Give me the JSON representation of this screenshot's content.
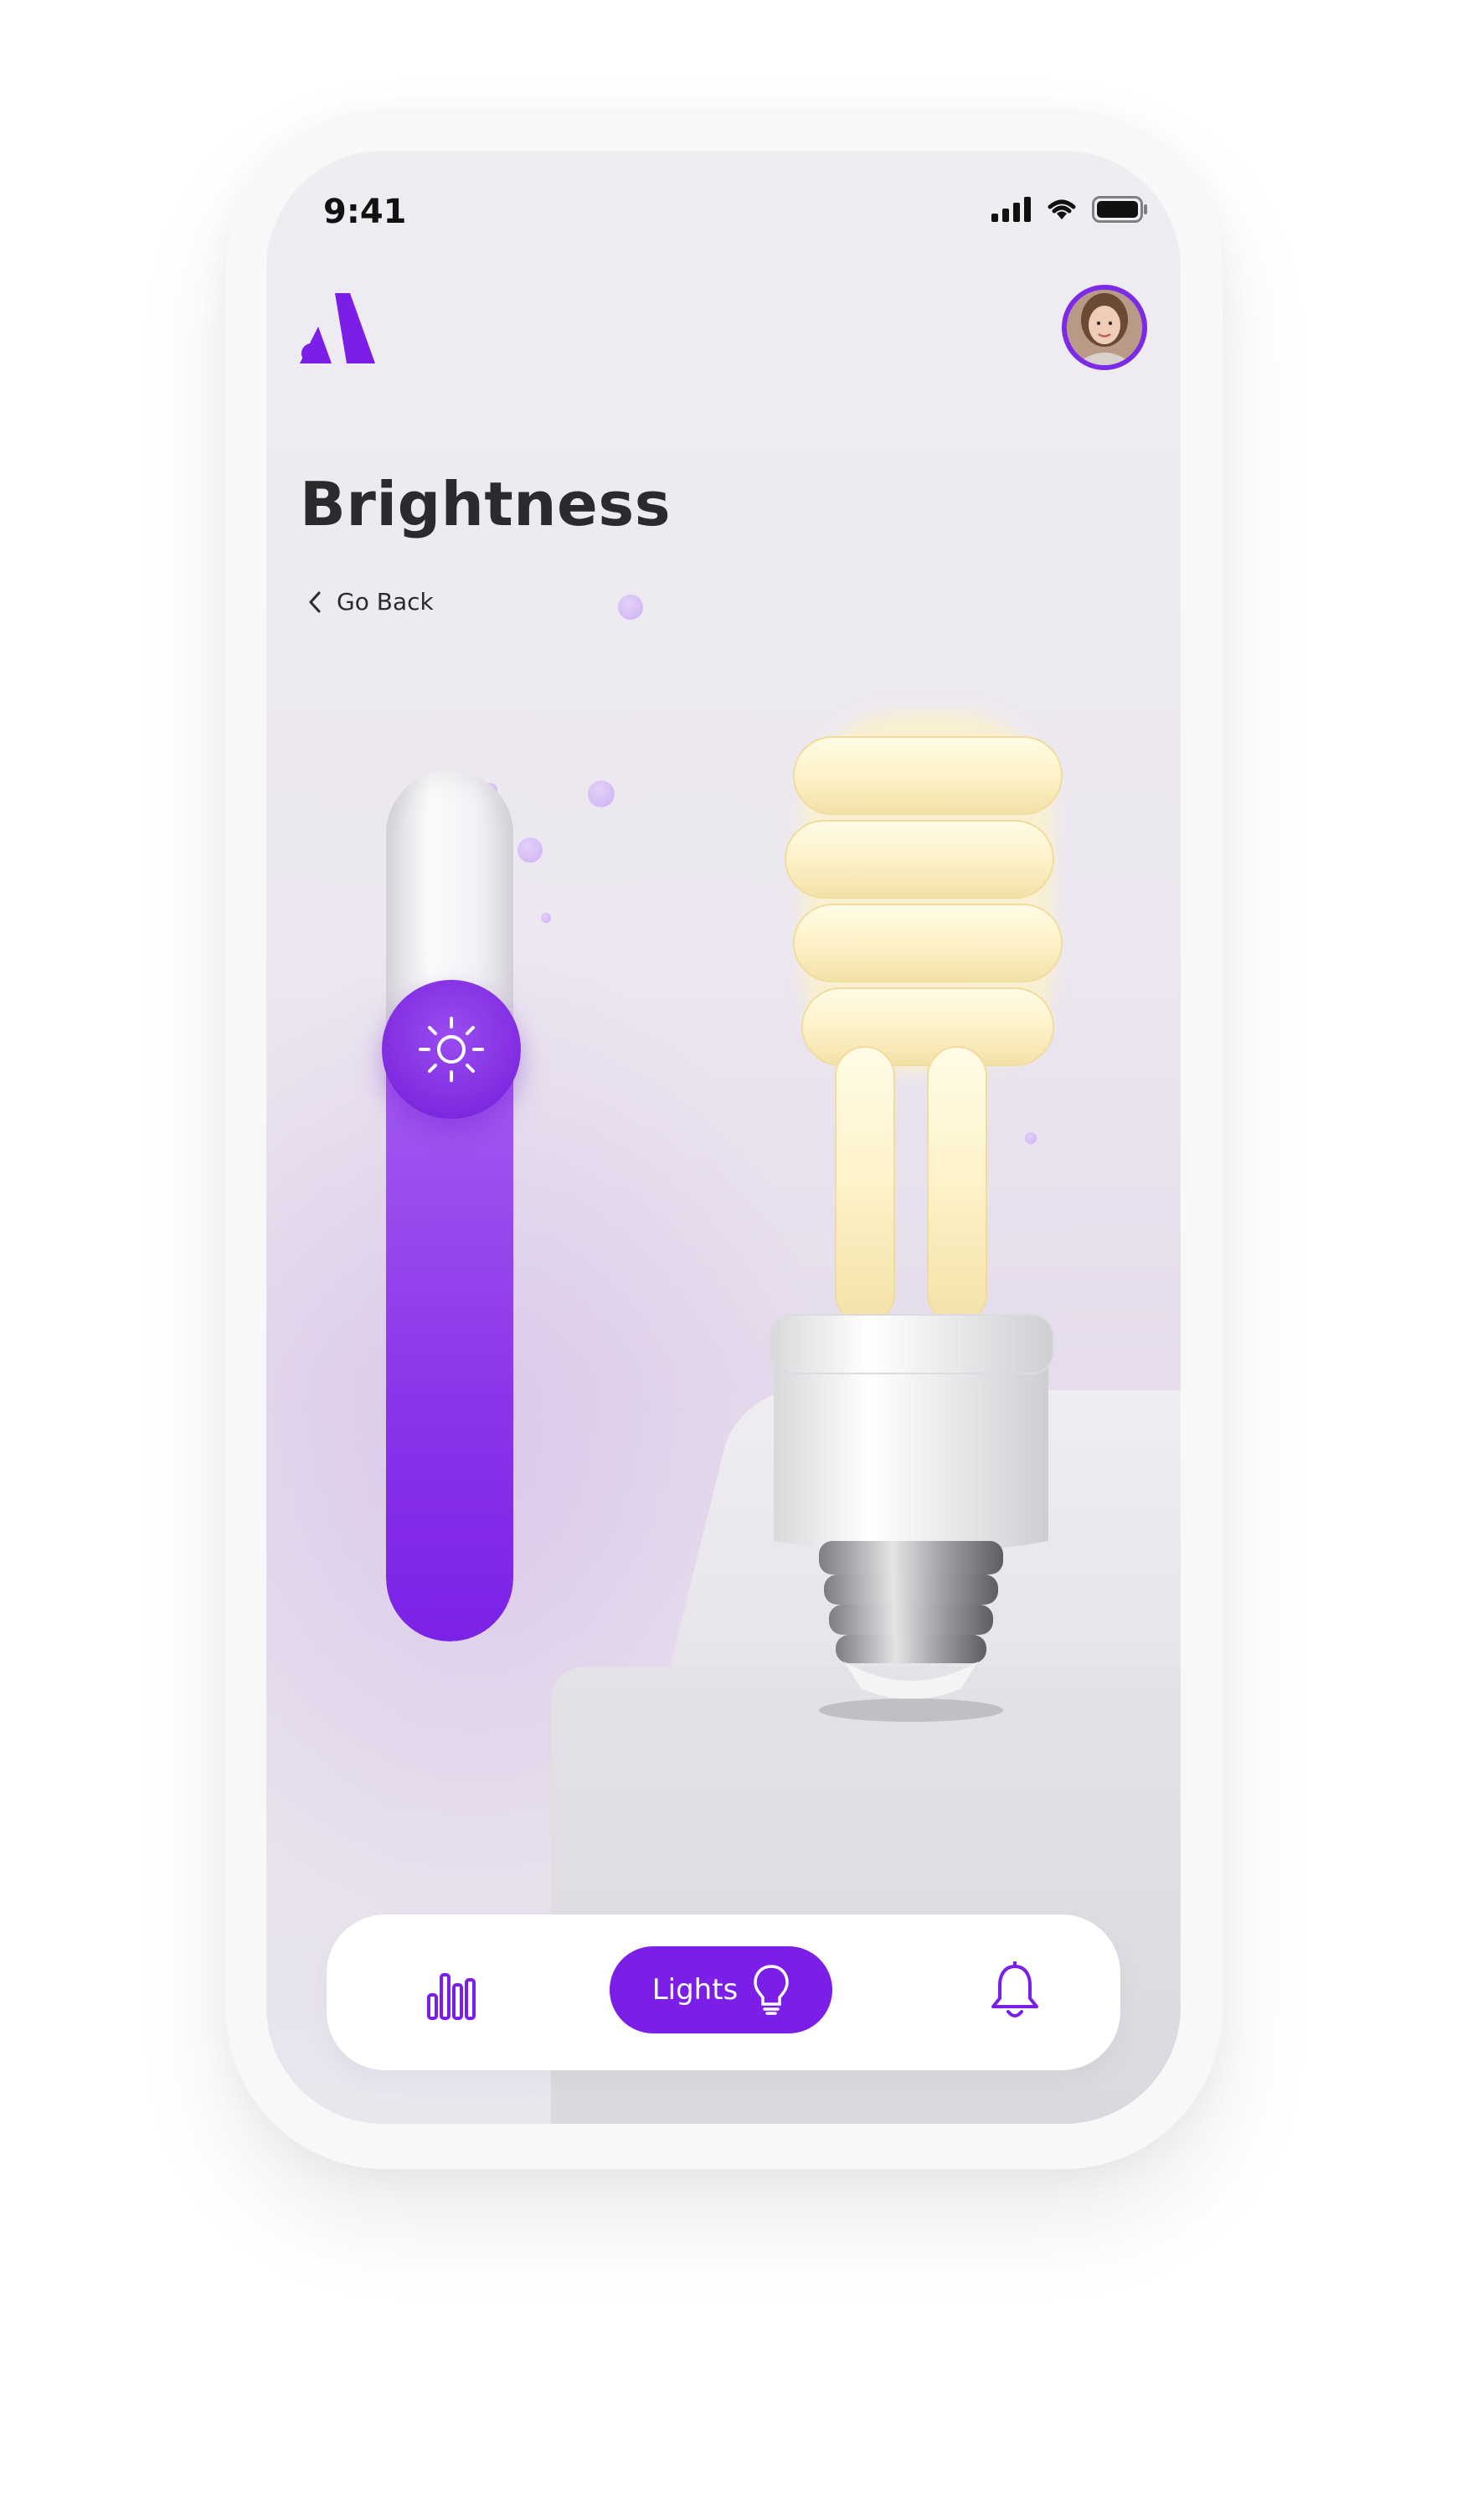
{
  "status_bar": {
    "time": "9:41"
  },
  "header": {
    "logo_icon": "brand-a-logo-icon",
    "avatar": "user-avatar"
  },
  "page": {
    "title": "Brightness",
    "back_label": "Go Back"
  },
  "brightness": {
    "level": 0.68,
    "icon": "sun-icon"
  },
  "bottom_nav": {
    "items": [
      {
        "name": "stats",
        "icon": "bar-chart-icon",
        "label": ""
      },
      {
        "name": "lights",
        "icon": "lightbulb-icon",
        "label": "Lights",
        "active": true
      },
      {
        "name": "notifications",
        "icon": "bell-icon",
        "label": ""
      }
    ]
  },
  "colors": {
    "accent": "#7a1ee8",
    "text": "#2b2b2e",
    "background": "#efedf2"
  }
}
